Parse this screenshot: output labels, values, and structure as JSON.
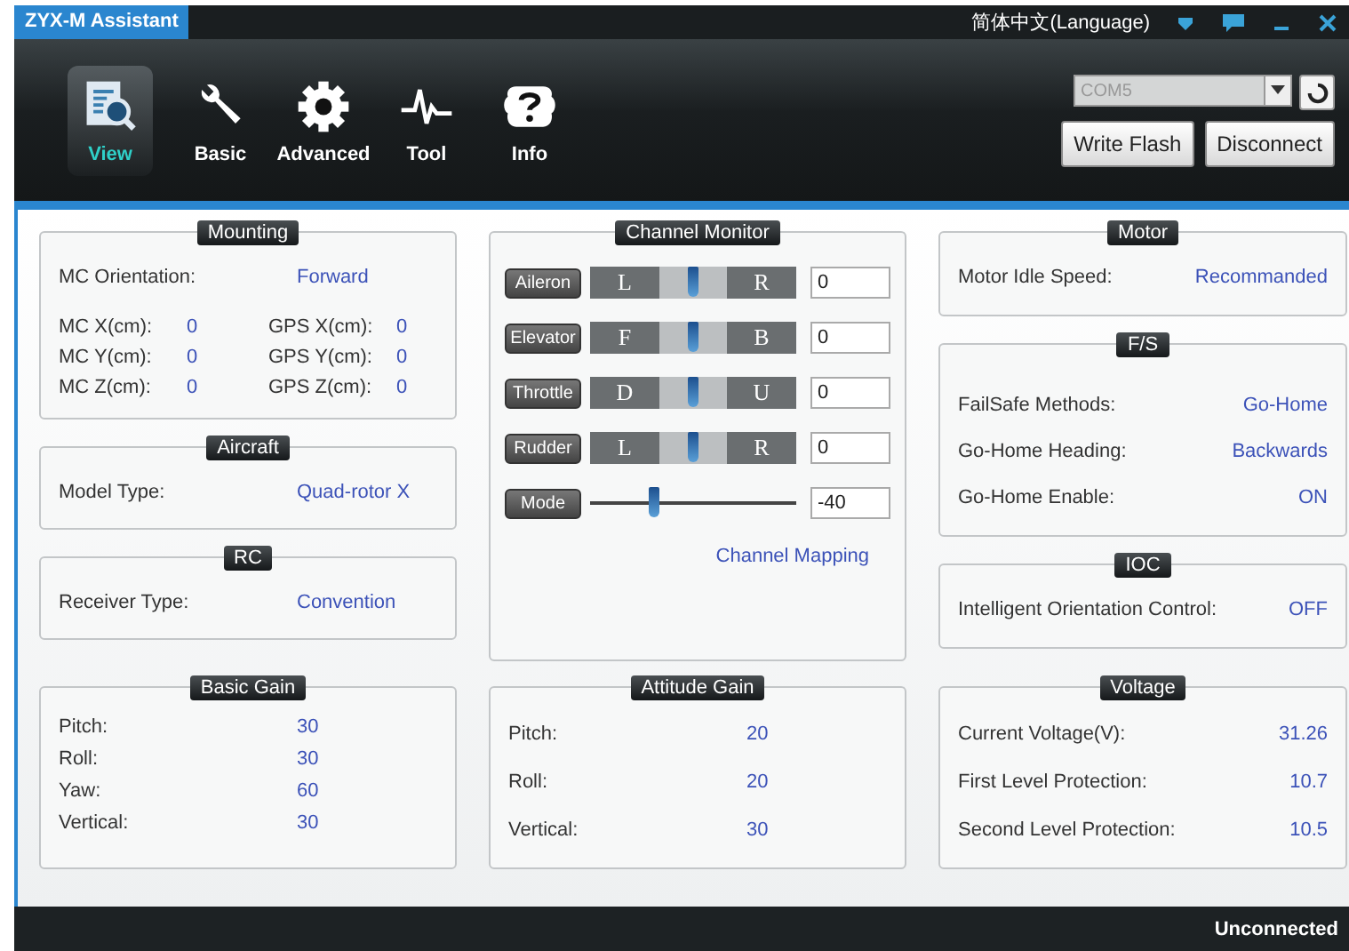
{
  "window": {
    "title": "ZYX-M Assistant",
    "language": "简体中文(Language)"
  },
  "tabs": [
    {
      "label": "View",
      "kind": "view",
      "selected": true
    },
    {
      "label": "Basic",
      "kind": "basic",
      "selected": false
    },
    {
      "label": "Advanced",
      "kind": "advanced",
      "selected": false
    },
    {
      "label": "Tool",
      "kind": "tool",
      "selected": false
    },
    {
      "label": "Info",
      "kind": "info",
      "selected": false
    }
  ],
  "port": {
    "value": "COM5"
  },
  "buttons": [
    "Write Flash",
    "Disconnect"
  ],
  "mounting": {
    "title": "Mounting",
    "orientation_label": "MC Orientation:",
    "orientation": "Forward",
    "rows": [
      {
        "mc_label": "MC X(cm):",
        "mc_value": "0",
        "gps_label": "GPS X(cm):",
        "gps_value": "0"
      },
      {
        "mc_label": "MC Y(cm):",
        "mc_value": "0",
        "gps_label": "GPS Y(cm):",
        "gps_value": "0"
      },
      {
        "mc_label": "MC Z(cm):",
        "mc_value": "0",
        "gps_label": "GPS Z(cm):",
        "gps_value": "0"
      }
    ]
  },
  "aircraft": {
    "title": "Aircraft",
    "rows": [
      {
        "label": "Model Type:",
        "value": "Quad-rotor X"
      }
    ]
  },
  "rc": {
    "title": "RC",
    "rows": [
      {
        "label": "Receiver Type:",
        "value": "Convention"
      }
    ]
  },
  "basic_gain": {
    "title": "Basic Gain",
    "rows": [
      {
        "label": "Pitch:",
        "value": "30"
      },
      {
        "label": "Roll:",
        "value": "30"
      },
      {
        "label": "Yaw:",
        "value": "60"
      },
      {
        "label": "Vertical:",
        "value": "30"
      }
    ]
  },
  "channel_monitor": {
    "title": "Channel Monitor",
    "channels": [
      {
        "kind": "stick",
        "name": "Aileron",
        "left": "L",
        "right": "R",
        "level": 0.5,
        "value": "0"
      },
      {
        "kind": "stick",
        "name": "Elevator",
        "left": "F",
        "right": "B",
        "level": 0.5,
        "value": "0"
      },
      {
        "kind": "stick",
        "name": "Throttle",
        "left": "D",
        "right": "U",
        "level": 0.5,
        "value": "0"
      },
      {
        "kind": "stick",
        "name": "Rudder",
        "left": "L",
        "right": "R",
        "level": 0.5,
        "value": "0"
      },
      {
        "kind": "mode",
        "name": "Mode",
        "level": 0.31,
        "value": "-40"
      }
    ],
    "link": "Channel Mapping"
  },
  "attitude_gain": {
    "title": "Attitude Gain",
    "rows": [
      {
        "label": "Pitch:",
        "value": "20"
      },
      {
        "label": "Roll:",
        "value": "20"
      },
      {
        "label": "Vertical:",
        "value": "30"
      }
    ]
  },
  "motor": {
    "title": "Motor",
    "rows": [
      {
        "label": "Motor Idle Speed:",
        "value": "Recommanded"
      }
    ]
  },
  "fs": {
    "title": "F/S",
    "rows": [
      {
        "label": "FailSafe Methods:",
        "value": "Go-Home"
      },
      {
        "label": "Go-Home Heading:",
        "value": "Backwards"
      },
      {
        "label": "Go-Home Enable:",
        "value": "ON"
      }
    ]
  },
  "ioc": {
    "title": "IOC",
    "rows": [
      {
        "label": "Intelligent Orientation Control:",
        "value": "OFF"
      }
    ]
  },
  "voltage": {
    "title": "Voltage",
    "rows": [
      {
        "label": "Current Voltage(V):",
        "value": "31.26"
      },
      {
        "label": "First Level Protection:",
        "value": "10.7"
      },
      {
        "label": "Second Level Protection:",
        "value": "10.5"
      }
    ]
  },
  "status_bar": {
    "text": "Unconnected"
  }
}
